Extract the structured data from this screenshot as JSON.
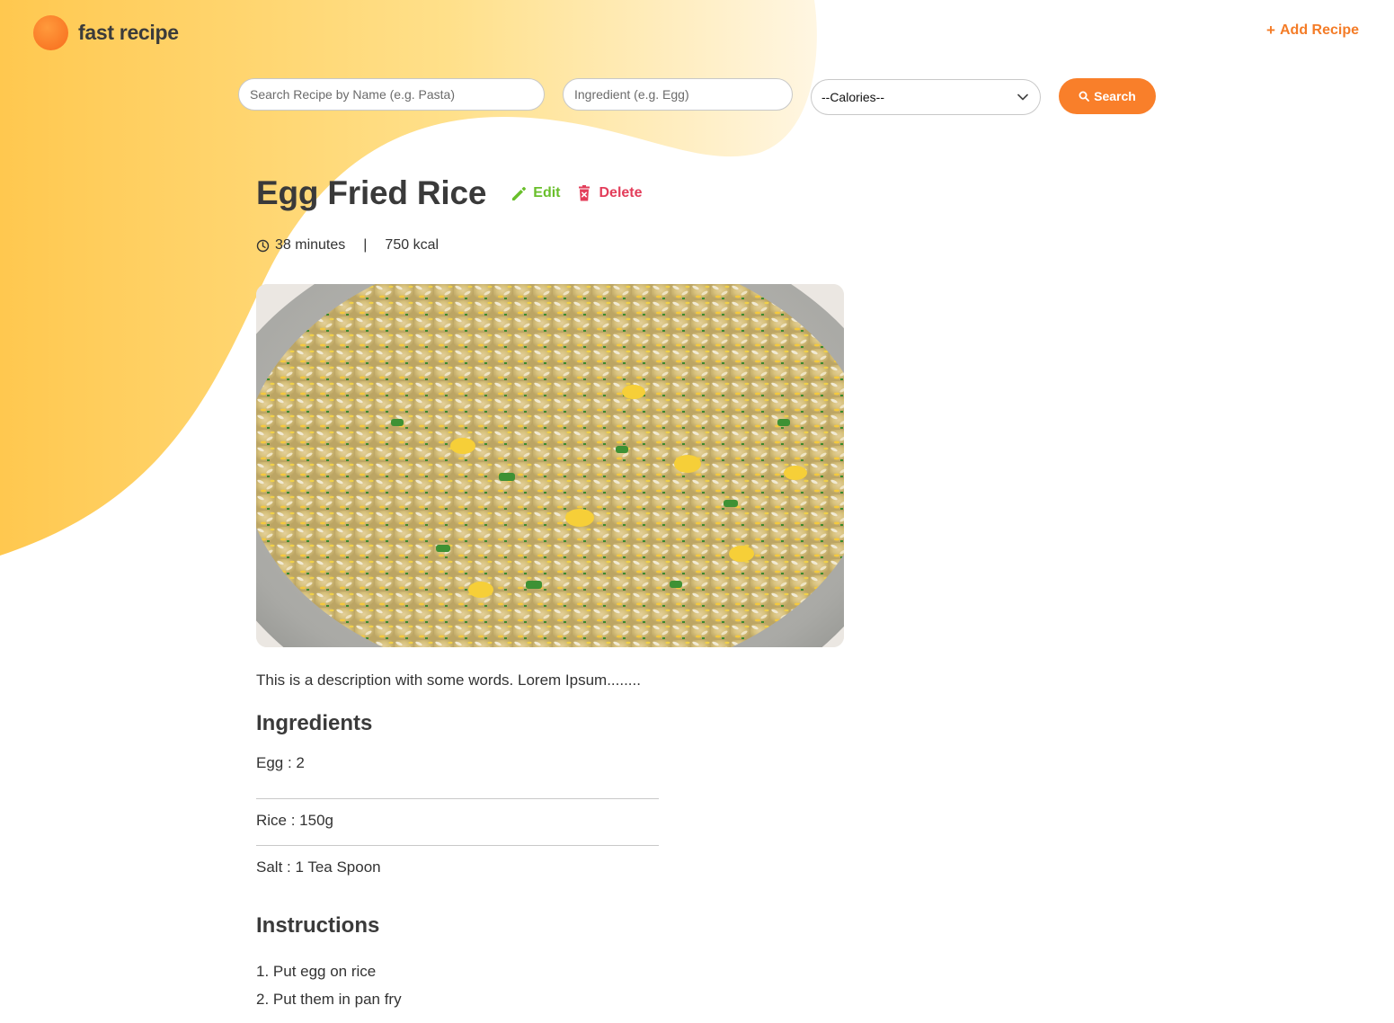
{
  "header": {
    "logo_text": "fast recipe",
    "add_recipe_label": "Add Recipe",
    "add_icon": "plus-icon"
  },
  "search": {
    "name_placeholder": "Search Recipe by Name (e.g. Pasta)",
    "ingredient_placeholder": "Ingredient (e.g. Egg)",
    "calories_selected": "--Calories--",
    "search_label": "Search",
    "search_icon": "search-icon"
  },
  "recipe": {
    "title": "Egg Fried Rice",
    "edit_label": "Edit",
    "delete_label": "Delete",
    "time": "38 minutes",
    "separator": "|",
    "calories": "750 kcal",
    "description": "This is a description with some words. Lorem Ipsum........",
    "ingredients_heading": "Ingredients",
    "ingredients": [
      "Egg : 2",
      "Rice : 150g",
      "Salt : 1 Tea Spoon"
    ],
    "instructions_heading": "Instructions",
    "instructions": [
      "1. Put egg on rice",
      "2. Put them in pan fry"
    ]
  },
  "colors": {
    "accent": "#f97f2a",
    "edit": "#69bf2b",
    "delete": "#e33d5a",
    "blob_start": "#ffc84f",
    "blob_end": "#fff3d6"
  }
}
